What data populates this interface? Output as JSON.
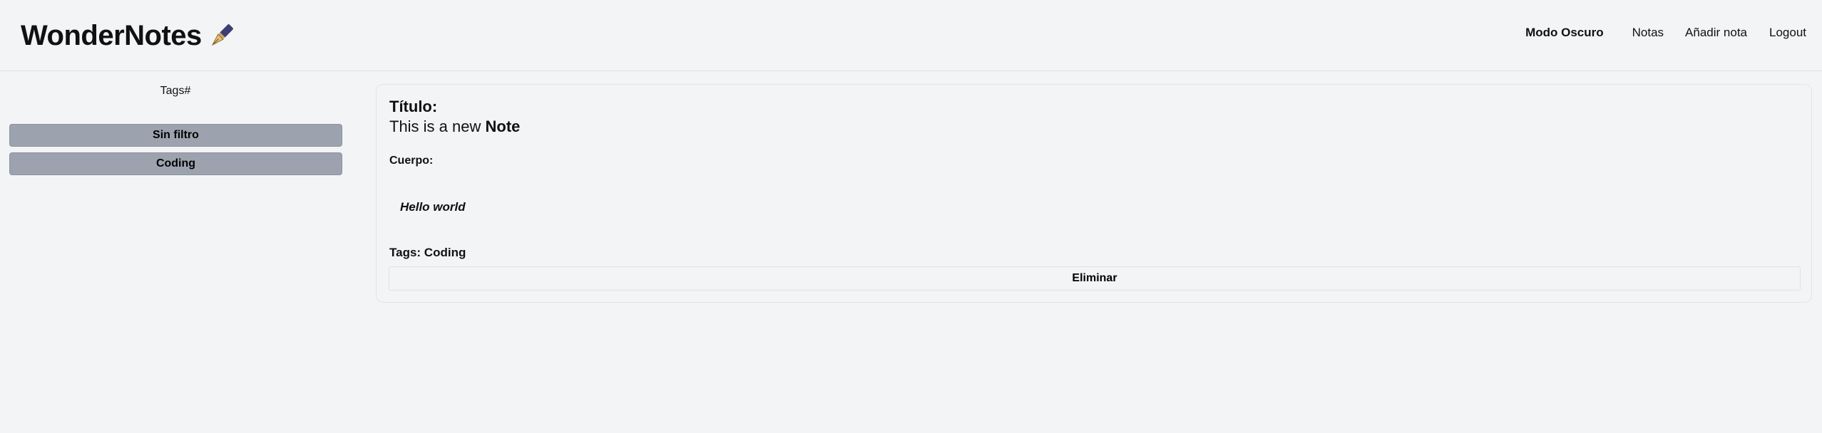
{
  "header": {
    "app_title": "WonderNotes",
    "logo_icon": "fountain-pen-icon",
    "nav": {
      "dark_mode": "Modo Oscuro",
      "notes": "Notas",
      "add_note": "Añadir nota",
      "logout": "Logout"
    }
  },
  "sidebar": {
    "title": "Tags#",
    "filters": [
      "Sin filtro",
      "Coding"
    ]
  },
  "note": {
    "title_label": "Título:",
    "title_prefix": "This is a new ",
    "title_emphasis": "Note",
    "body_label": "Cuerpo:",
    "body_text": "Hello world",
    "tags_text": "Tags: Coding",
    "delete_label": "Eliminar"
  },
  "colors": {
    "background": "#f3f4f6",
    "tag_button": "#9ca3af",
    "text": "#111111"
  }
}
